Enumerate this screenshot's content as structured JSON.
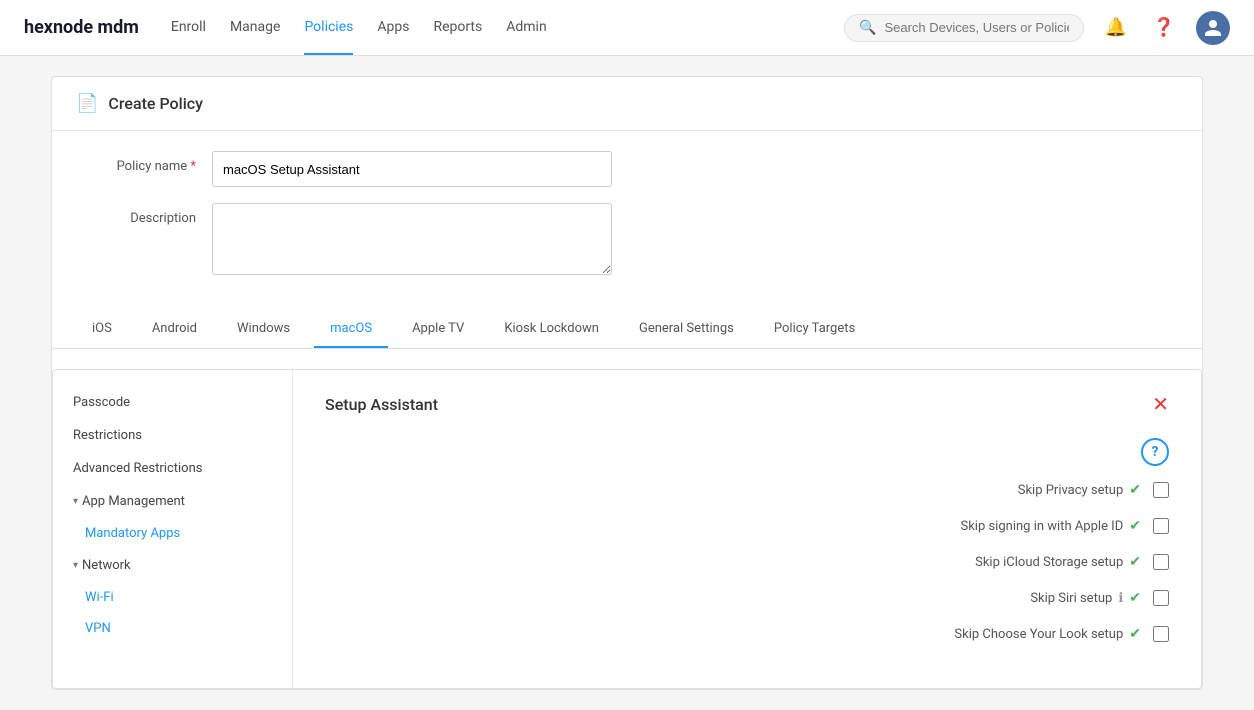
{
  "brand": {
    "name": "hexnode mdm",
    "logo_text": "hexnode mdm"
  },
  "nav": {
    "links": [
      {
        "id": "enroll",
        "label": "Enroll",
        "active": false
      },
      {
        "id": "manage",
        "label": "Manage",
        "active": false
      },
      {
        "id": "policies",
        "label": "Policies",
        "active": true
      },
      {
        "id": "apps",
        "label": "Apps",
        "active": false
      },
      {
        "id": "reports",
        "label": "Reports",
        "active": false
      },
      {
        "id": "admin",
        "label": "Admin",
        "active": false
      }
    ],
    "search_placeholder": "Search Devices, Users or Policies"
  },
  "page": {
    "title": "Create Policy",
    "policy_name_label": "Policy name",
    "policy_name_value": "macOS Setup Assistant",
    "description_label": "Description",
    "description_value": ""
  },
  "tabs": [
    {
      "id": "ios",
      "label": "iOS",
      "active": false
    },
    {
      "id": "android",
      "label": "Android",
      "active": false
    },
    {
      "id": "windows",
      "label": "Windows",
      "active": false
    },
    {
      "id": "macos",
      "label": "macOS",
      "active": true
    },
    {
      "id": "apple-tv",
      "label": "Apple TV",
      "active": false
    },
    {
      "id": "kiosk-lockdown",
      "label": "Kiosk Lockdown",
      "active": false
    },
    {
      "id": "general-settings",
      "label": "General Settings",
      "active": false
    },
    {
      "id": "policy-targets",
      "label": "Policy Targets",
      "active": false
    }
  ],
  "sidebar": {
    "items": [
      {
        "id": "passcode",
        "label": "Passcode",
        "type": "item",
        "active": false
      },
      {
        "id": "restrictions",
        "label": "Restrictions",
        "type": "item",
        "active": false
      },
      {
        "id": "advanced-restrictions",
        "label": "Advanced Restrictions",
        "type": "item",
        "active": false
      },
      {
        "id": "app-management",
        "label": "App Management",
        "type": "group",
        "expanded": true
      },
      {
        "id": "mandatory-apps",
        "label": "Mandatory Apps",
        "type": "subitem",
        "active": true
      },
      {
        "id": "network",
        "label": "Network",
        "type": "group",
        "expanded": true
      },
      {
        "id": "wifi",
        "label": "Wi-Fi",
        "type": "subitem",
        "active": false
      },
      {
        "id": "vpn",
        "label": "VPN",
        "type": "subitem",
        "active": false
      }
    ]
  },
  "panel": {
    "title": "Setup Assistant",
    "setup_items": [
      {
        "id": "skip-privacy",
        "label": "Skip Privacy setup",
        "has_check": true,
        "has_info": false
      },
      {
        "id": "skip-apple-id",
        "label": "Skip signing in with Apple ID",
        "has_check": true,
        "has_info": false
      },
      {
        "id": "skip-icloud",
        "label": "Skip iCloud Storage setup",
        "has_check": true,
        "has_info": false
      },
      {
        "id": "skip-siri",
        "label": "Skip Siri setup",
        "has_check": true,
        "has_info": true
      },
      {
        "id": "skip-choose-look",
        "label": "Skip Choose Your Look setup",
        "has_check": true,
        "has_info": false
      }
    ]
  }
}
